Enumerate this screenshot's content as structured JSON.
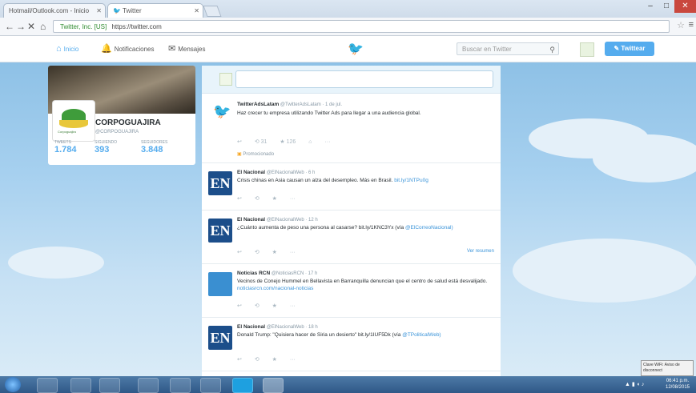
{
  "browser": {
    "tabs": [
      {
        "label": "Hotmail/Outlook.com - Inicio"
      },
      {
        "label": "Twitter"
      }
    ],
    "url_secure_label": "Twitter, Inc. [US]",
    "url": "https://twitter.com",
    "window_controls": [
      "–",
      "□",
      "✕"
    ]
  },
  "twitter_nav": {
    "home_label": "Inicio",
    "notifications_label": "Notificaciones",
    "messages_label": "Mensajes",
    "search_placeholder": "Buscar en Twitter",
    "tweet_button": "Twittear"
  },
  "profile": {
    "name": "CORPOGUAJIRA",
    "handle": "@CORPOGUAJIRA",
    "avatar_text": "Corpoguajira",
    "stats": [
      {
        "label": "TWEETS",
        "value": "1.784"
      },
      {
        "label": "SIGUIENDO",
        "value": "393"
      },
      {
        "label": "SEGUIDORES",
        "value": "3.848"
      }
    ]
  },
  "timeline": {
    "tweets": [
      {
        "author": "TwitterAdsLatam",
        "handle": "@TwitterAdsLatam · 1 de jul.",
        "text": "Haz crecer tu empresa utilizando Twitter Ads para llegar a una audiencia global.",
        "actions": [
          "↩",
          "⟲ 31",
          "★ 126",
          "⌂",
          "···"
        ],
        "promo": "Promocionado"
      },
      {
        "author": "El Nacional",
        "handle": "@ElNacionalWeb · 6 h",
        "text": "Crisis chinas en Asia causan un alza del desempleo. Más en Brasil.",
        "link": "bit.ly/1NTPu0g",
        "actions": [
          "↩",
          "⟲",
          "★",
          "···"
        ]
      },
      {
        "author": "El Nacional",
        "handle": "@ElNacionalWeb · 12 h",
        "text": "¿Cuánto aumenta de peso una persona al casarse? bit.ly/1KNC3Yx (vía",
        "link": "@ElCorreoNacional)",
        "actions": [
          "↩",
          "⟲",
          "★",
          "···"
        ],
        "more": "Ver resumen"
      },
      {
        "author": "Noticias RCN",
        "handle": "@NoticiasRCN · 17 h",
        "text": "Vecinos de Conejo Hummel en Bellavista en Barranquilla denuncian que el centro de salud está desvalijado.",
        "link": "noticiasrcn.com/nacional-noticias",
        "actions": [
          "↩",
          "⟲",
          "★",
          "···"
        ]
      },
      {
        "author": "El Nacional",
        "handle": "@ElNacionalWeb · 18 h",
        "text": "Donald Trump: \"Quisiera hacer de Siria un desierto\" bit.ly/1IUF5Dk (vía",
        "link": "@TPoliticalWeb)",
        "actions": [
          "↩",
          "⟲",
          "★",
          "···"
        ]
      }
    ]
  },
  "system": {
    "notification_text": "Clave WiFi: Aviso de disconnect",
    "clock_time": "06:41 p.m.",
    "clock_date": "12/08/2015"
  },
  "colors": {
    "twitter_blue": "#55acee",
    "link_blue": "#3b94d9",
    "en_logo": "#1c4e8a",
    "sky": "#a6d0ef"
  }
}
